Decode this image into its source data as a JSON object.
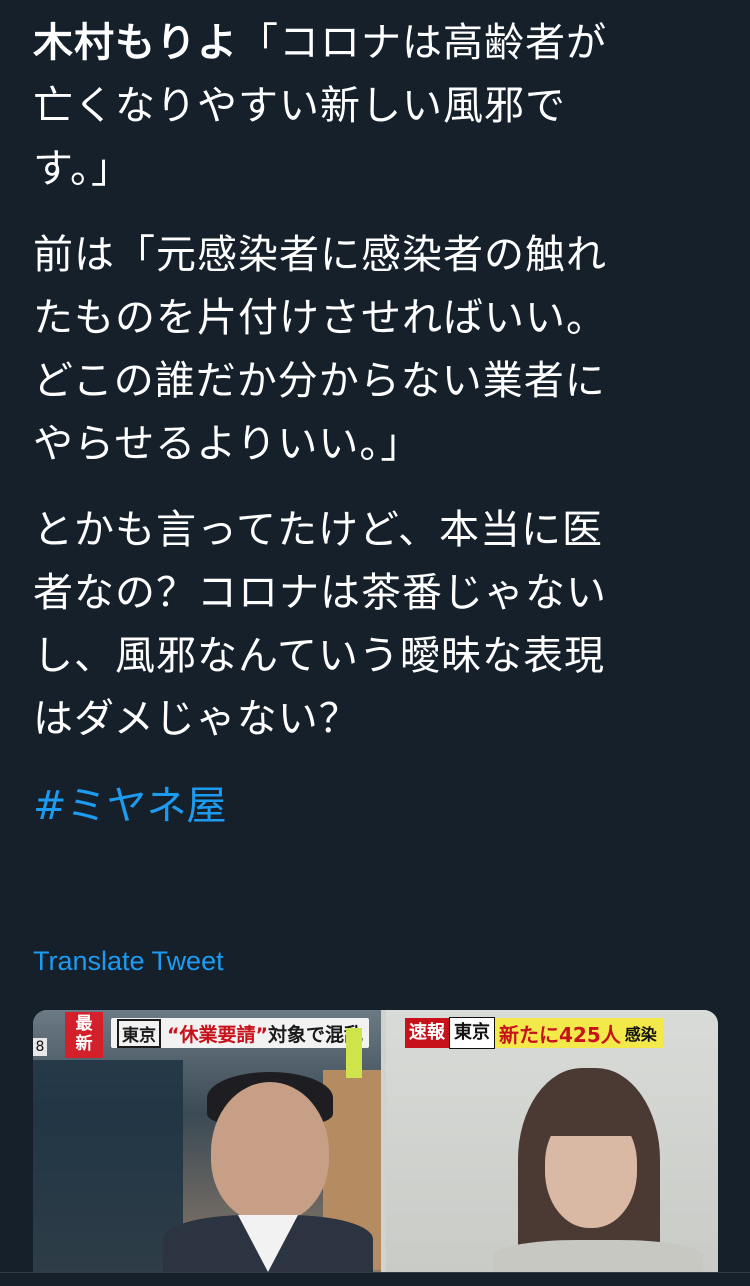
{
  "tweet": {
    "author_name": "木村もりよ",
    "quote_line": "「コロナは高齢者が\n亡くなりやすい新しい風邪で\nす。」",
    "paragraph2": "前は「元感染者に感染者の触れ\nたものを片付けさせればいい。\nどこの誰だか分からない業者に\nやらせるよりいい。」",
    "paragraph3": "とかも言ってたけど、本当に医\n者なの？コロナは茶番じゃない\nし、風邪なんていう曖昧な表現\nはダメじゃない？",
    "hashtag": "#ミヤネ屋",
    "translate_label": "Translate Tweet"
  },
  "media": {
    "tag_label": "最\n新",
    "left_edge_number": "8",
    "left_ticker": {
      "place": "東京",
      "quote": "“休業要請”",
      "rest": "対象で混乱"
    },
    "right_ticker": {
      "flash": "速報",
      "place": "東京",
      "count": "新たに425人",
      "suffix": "感染"
    }
  },
  "colors": {
    "background": "#15202b",
    "text": "#ffffff",
    "link": "#1d9bf0",
    "news_red": "#c8121b",
    "news_yellow": "#f4e94a"
  }
}
